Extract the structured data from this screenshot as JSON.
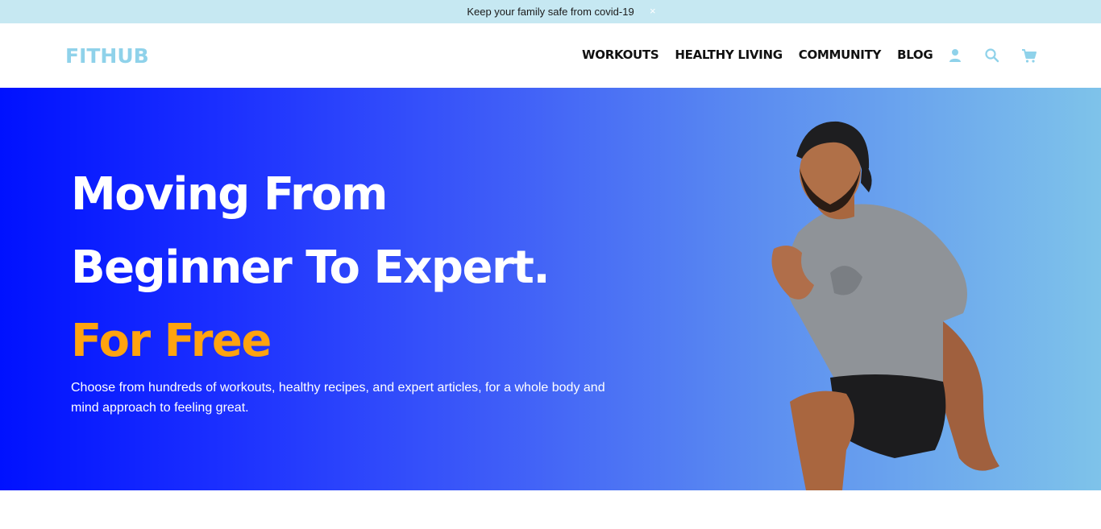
{
  "announcement": {
    "text": "Keep your family safe from covid-19",
    "close_label": "×"
  },
  "header": {
    "logo": "FITHUB",
    "nav": [
      "WORKOUTS",
      "HEALTHY LIVING",
      "COMMUNITY",
      "BLOG"
    ],
    "icons": [
      "user-icon",
      "search-icon",
      "cart-icon"
    ]
  },
  "hero": {
    "line1": "Moving From",
    "line2": "Beginner To Expert.",
    "line3": "For Free",
    "description": "Choose from hundreds of workouts, healthy recipes, and expert articles, for a whole body and mind approach to feeling great."
  },
  "colors": {
    "logo": "#8fd2ea",
    "accent": "#ffa30f",
    "announce_bg": "#c6e8f2",
    "gradient_start": "#0011ff",
    "gradient_end": "#7ec3ea"
  }
}
